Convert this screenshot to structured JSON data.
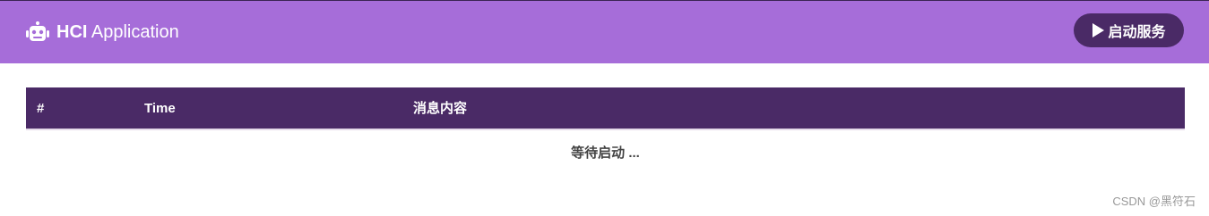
{
  "header": {
    "brand_bold": "HCI",
    "brand_rest": "Application",
    "start_button_label": "启动服务",
    "colors": {
      "bar": "#a66dd9",
      "button": "#4a2a66"
    }
  },
  "table": {
    "columns": [
      "#",
      "Time",
      "消息内容"
    ],
    "status_text": "等待启动 ..."
  },
  "watermark": "CSDN @黑符石"
}
